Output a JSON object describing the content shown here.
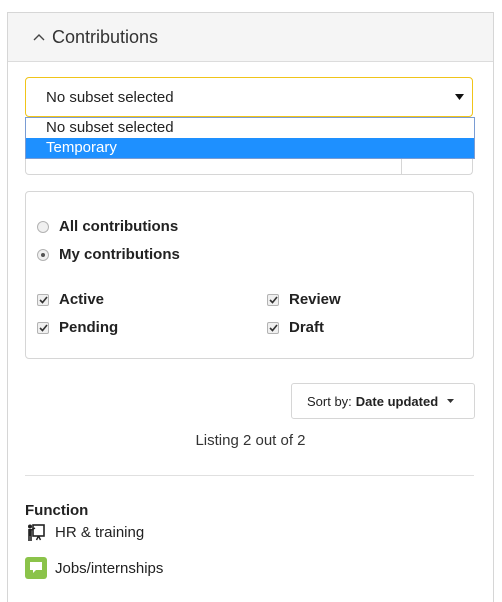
{
  "panel": {
    "title": "Contributions"
  },
  "subset_select": {
    "value": "No subset selected",
    "options": [
      "No subset selected",
      "Temporary"
    ],
    "highlighted_option": "Temporary"
  },
  "filters": {
    "radios": [
      {
        "label": "All contributions",
        "checked": false
      },
      {
        "label": "My contributions",
        "checked": true
      }
    ],
    "checkboxes": [
      {
        "label": "Active",
        "checked": true
      },
      {
        "label": "Review",
        "checked": true
      },
      {
        "label": "Pending",
        "checked": true
      },
      {
        "label": "Draft",
        "checked": true
      }
    ]
  },
  "sort": {
    "prefix": "Sort by:",
    "value": "Date updated"
  },
  "listing": {
    "text": "Listing 2 out of 2"
  },
  "function": {
    "title": "Function",
    "items": [
      {
        "label": "HR & training",
        "icon": "hr-training-icon"
      },
      {
        "label": "Jobs/internships",
        "icon": "speech-bubble-icon",
        "color": "#8bc34a"
      }
    ]
  },
  "colors": {
    "focus_border": "#f0c419",
    "highlight": "#1e90ff",
    "jobs_icon": "#8bc34a"
  }
}
